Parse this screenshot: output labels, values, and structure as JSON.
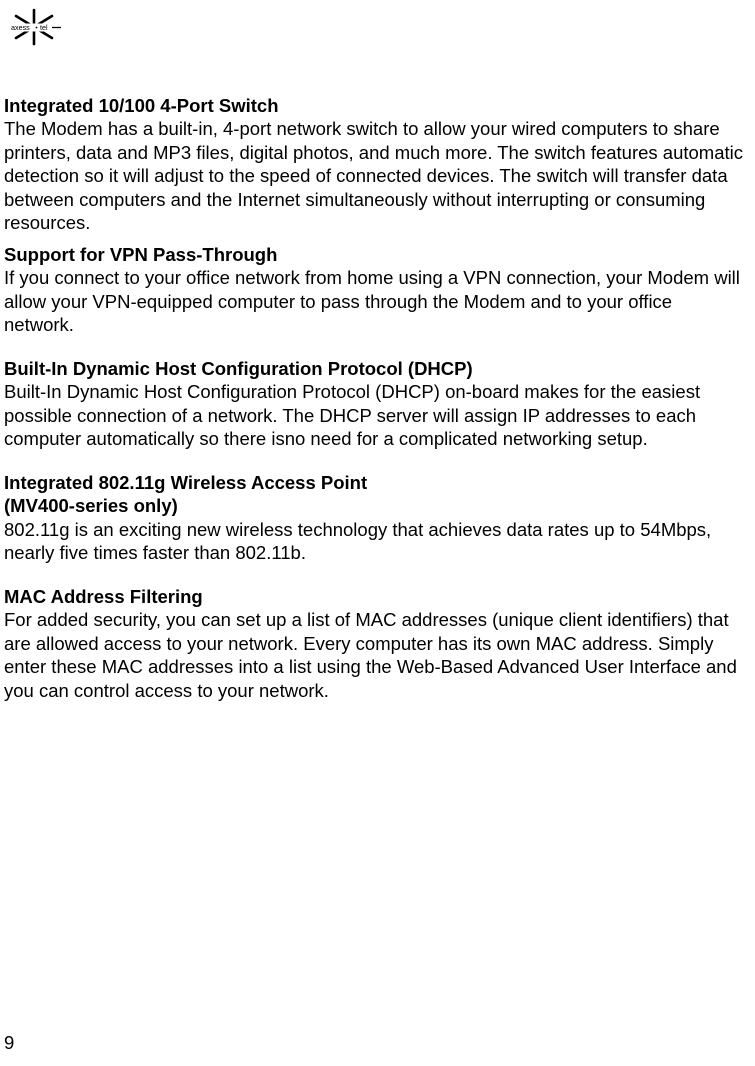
{
  "logo": {
    "text": "axess tel"
  },
  "sections": [
    {
      "heading": "Integrated 10/100 4-Port Switch",
      "body": "The Modem has a built-in, 4-port network switch to allow your wired computers to share printers, data and MP3 files, digital photos, and much more. The switch features automatic detection so it will adjust to the speed of connected devices. The switch will transfer data between computers and the Internet simultaneously without interrupting or consuming resources."
    },
    {
      "heading": "Support for VPN Pass-Through",
      "body": "If you connect to your office network from home using a VPN connection, your Modem will allow your VPN-equipped computer to pass through the Modem and to your office network."
    },
    {
      "heading": "Built-In Dynamic Host Configuration Protocol (DHCP)",
      "body": "Built-In Dynamic Host Configuration Protocol (DHCP) on-board makes for the easiest possible connection of a network. The DHCP server will assign IP addresses to each computer automatically so there isno need for a complicated networking setup."
    },
    {
      "heading": "Integrated 802.11g Wireless Access Point",
      "subheading": "(MV400-series only)",
      "body": "802.11g is an exciting new wireless technology that achieves data rates up to 54Mbps, nearly five times faster than 802.11b."
    },
    {
      "heading": "MAC Address Filtering",
      "body": "For added security, you can set up a list of MAC addresses (unique client identifiers) that are allowed access to your network. Every computer has its own MAC address. Simply enter these MAC addresses into a list using the Web-Based Advanced User Interface and you can control access to your network."
    }
  ],
  "pageNumber": "9"
}
